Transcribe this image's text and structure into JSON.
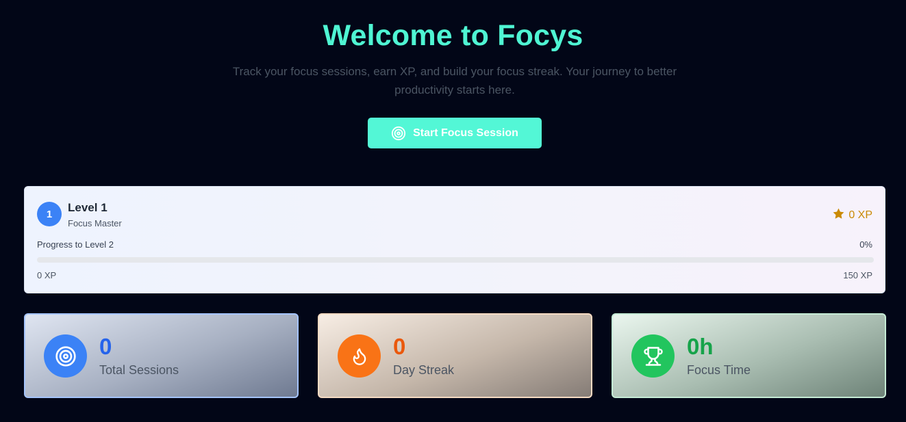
{
  "hero": {
    "title": "Welcome to Focys",
    "subtitle": "Track your focus sessions, earn XP, and build your focus streak. Your journey to better productivity starts here.",
    "start_button_label": "Start Focus Session",
    "start_button_icon": "target-icon"
  },
  "level_card": {
    "level_number": "1",
    "level_title": "Level 1",
    "level_subtitle": "Focus Master",
    "xp_icon": "star-icon",
    "xp_total": "0 XP",
    "progress_label": "Progress to Level 2",
    "progress_percent_text": "0%",
    "progress_fraction": 0,
    "progress_min": "0 XP",
    "progress_max": "150 XP"
  },
  "stats": [
    {
      "icon": "target-icon",
      "value": "0",
      "label": "Total Sessions"
    },
    {
      "icon": "flame-icon",
      "value": "0",
      "label": "Day Streak"
    },
    {
      "icon": "trophy-icon",
      "value": "0h",
      "label": "Focus Time"
    }
  ],
  "colors": {
    "background": "#020617",
    "accent": "#4ff5d3",
    "level_badge": "#3b82f6",
    "xp": "#ca8a04",
    "sessions": "#2563eb",
    "streak": "#ea580c",
    "focus_time": "#16a34a"
  }
}
